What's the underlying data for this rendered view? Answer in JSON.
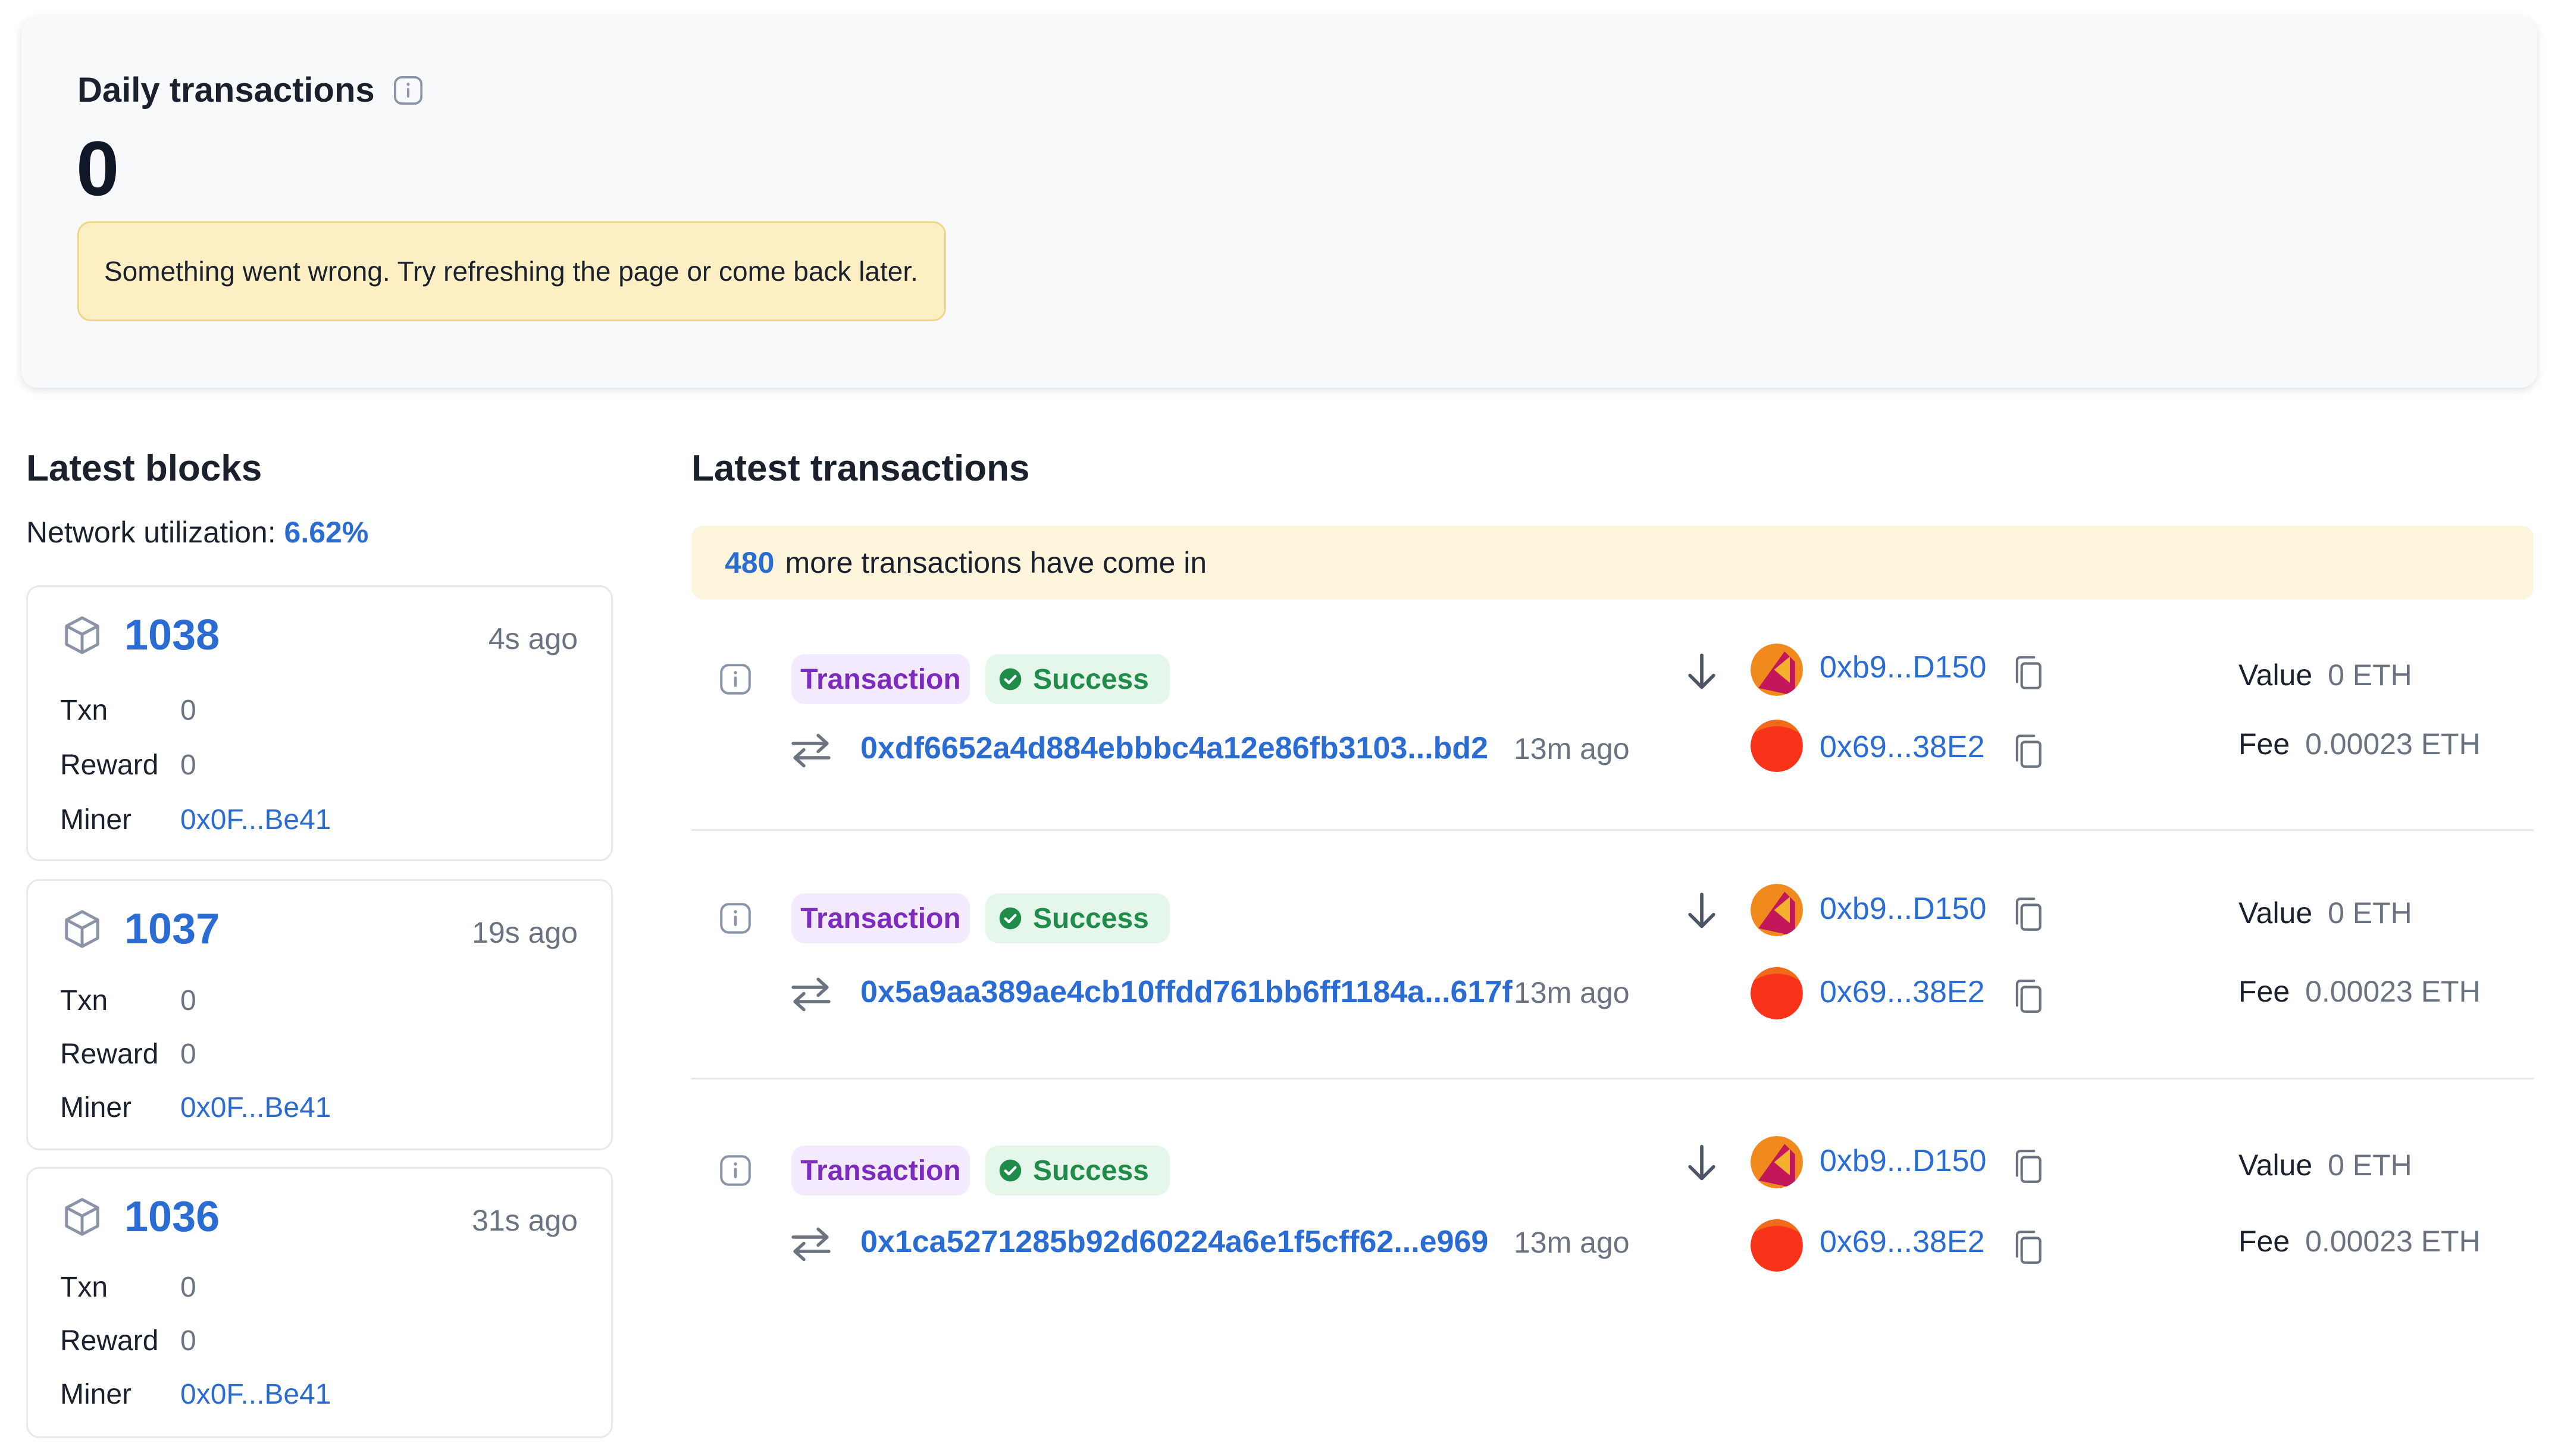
{
  "daily": {
    "title": "Daily transactions",
    "value": "0",
    "error": "Something went wrong. Try refreshing the page or come back later."
  },
  "blocks": {
    "title": "Latest blocks",
    "utilization_label": "Network utilization:",
    "utilization_value": "6.62%",
    "labels": {
      "txn": "Txn",
      "reward": "Reward",
      "miner": "Miner"
    },
    "items": [
      {
        "number": "1038",
        "age": "4s ago",
        "txn": "0",
        "reward": "0",
        "miner": "0x0F...Be41"
      },
      {
        "number": "1037",
        "age": "19s ago",
        "txn": "0",
        "reward": "0",
        "miner": "0x0F...Be41"
      },
      {
        "number": "1036",
        "age": "31s ago",
        "txn": "0",
        "reward": "0",
        "miner": "0x0F...Be41"
      }
    ]
  },
  "transactions": {
    "title": "Latest transactions",
    "banner_count": "480",
    "banner_text": "more transactions have come in",
    "labels": {
      "value": "Value",
      "fee": "Fee"
    },
    "items": [
      {
        "type": "Transaction",
        "status": "Success",
        "hash": "0xdf6652a4d884ebbbc4a12e86fb3103...bd2",
        "age": "13m ago",
        "from": "0xb9...D150",
        "to": "0x69...38E2",
        "value": "0 ETH",
        "fee": "0.00023 ETH"
      },
      {
        "type": "Transaction",
        "status": "Success",
        "hash": "0x5a9aa389ae4cb10ffdd761bb6ff1184a...617f",
        "age": "13m ago",
        "from": "0xb9...D150",
        "to": "0x69...38E2",
        "value": "0 ETH",
        "fee": "0.00023 ETH"
      },
      {
        "type": "Transaction",
        "status": "Success",
        "hash": "0x1ca5271285b92d60224a6e1f5cff62...e969",
        "age": "13m ago",
        "from": "0xb9...D150",
        "to": "0x69...38E2",
        "value": "0 ETH",
        "fee": "0.00023 ETH"
      }
    ]
  },
  "icons": {
    "info": "info-icon",
    "block": "cube-icon",
    "swap": "swap-arrows-icon",
    "direction": "arrow-down-icon",
    "copy": "copy-icon",
    "status": "check-circle-icon"
  },
  "colors": {
    "link": "#2b6cd3",
    "tag_type_bg": "#f4eafd",
    "tag_type_text": "#7b2cbf",
    "tag_status_bg": "#e5f6ea",
    "tag_status_text": "#1f8c4a",
    "alert_bg": "#fcefc4",
    "banner_bg": "#fdf4dc"
  }
}
